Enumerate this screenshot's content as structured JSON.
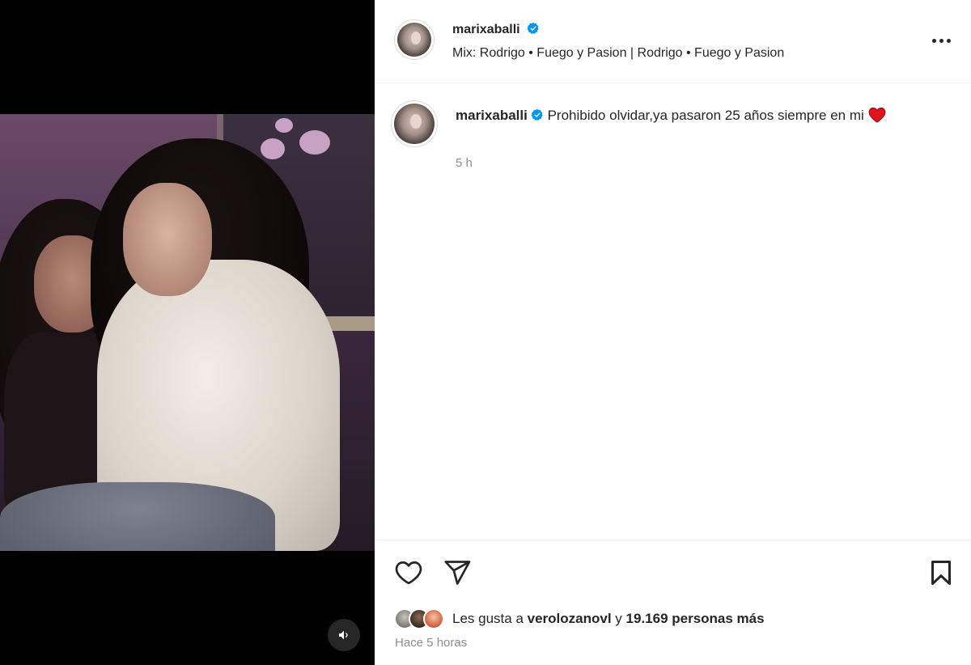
{
  "post": {
    "username": "marixaballi",
    "music": "Mix: Rodrigo • Fuego y Pasion | Rodrigo • Fuego y Pasion",
    "caption_text": "Prohibido olvidar,ya pasaron 25 años siempre en mi",
    "caption_emoji": "red-heart-emoji",
    "time_ago": "5 h",
    "likes_prefix": "Les gusta a",
    "likes_user": "verolozanovl",
    "likes_join": "y",
    "likes_count": "19.169 personas más",
    "date": "Hace 5 horas"
  },
  "icons": {
    "verified": "verified-badge-icon",
    "more": "more-options-icon",
    "like": "heart-outline-icon",
    "share": "paper-plane-icon",
    "save": "bookmark-icon",
    "sound": "speaker-icon"
  },
  "colors": {
    "verified_blue": "#0095f6",
    "emoji_red": "#e0141e",
    "secondary_text": "#8e8e8e"
  }
}
